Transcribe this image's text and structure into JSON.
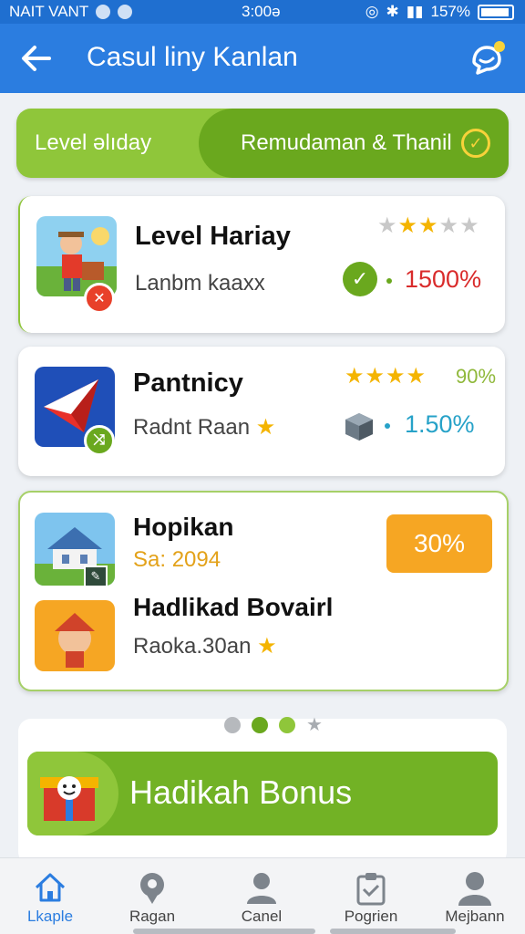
{
  "status_bar": {
    "carrier": "NAIT VANT",
    "time": "3:00ə",
    "battery": "157%"
  },
  "app_bar": {
    "title": "Casul liny Kanlan",
    "back_icon": "arrow-left-icon",
    "action_icon": "chat-bubble-icon"
  },
  "segment": {
    "left_label": "Level ǝlıday",
    "right_label": "Remudaman & Thanil"
  },
  "cards": [
    {
      "title": "Level Hariay",
      "subtitle": "Lanbm kaaxx",
      "stars_filled": 3,
      "stars_total": 5,
      "value": "1500%",
      "value_color": "#d92b2b",
      "status_icon": "check-circle-icon"
    },
    {
      "title": "Pantnicy",
      "subtitle": "Radnt Raan",
      "stars_filled": 4,
      "rating_text": "90%",
      "value": "1.50%",
      "value_color": "#27a2c8",
      "status_icon": "cube-icon"
    }
  ],
  "offer": {
    "item1_title": "Hopikan",
    "item1_price": "Sa: 2094",
    "percent": "30%",
    "item2_title": "Hadlikad Bovairl",
    "item2_subtitle": "Raoka.30an"
  },
  "pager": {
    "count": 4,
    "active_index": 1
  },
  "bonus": {
    "label": "Hadikah Bonus"
  },
  "nav": [
    {
      "label": "Lkaple",
      "icon": "home-icon",
      "active": true
    },
    {
      "label": "Ragan",
      "icon": "search-pin-icon",
      "active": false
    },
    {
      "label": "Canel",
      "icon": "person-icon",
      "active": false
    },
    {
      "label": "Pogrien",
      "icon": "clipboard-icon",
      "active": false
    },
    {
      "label": "Mejbann",
      "icon": "profile-icon",
      "active": false
    }
  ],
  "colors": {
    "primary": "#2b7de0",
    "accent_green": "#72b225",
    "orange": "#f6a623",
    "red_value": "#d92b2b",
    "teal_value": "#27a2c8",
    "star": "#f4b400"
  }
}
